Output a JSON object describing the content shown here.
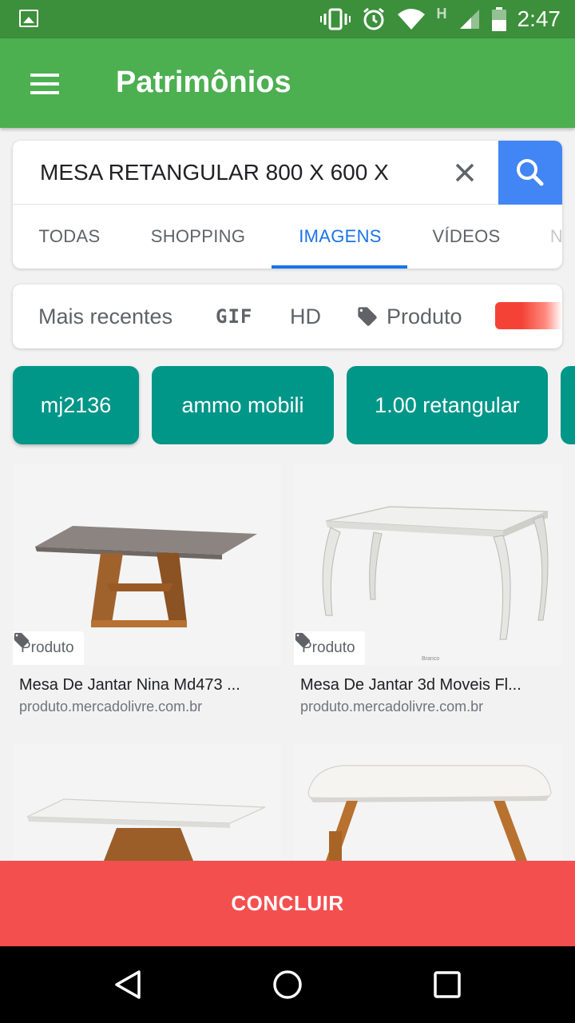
{
  "status_bar": {
    "time": "2:47",
    "network_label": "H",
    "icons": [
      "gallery-icon",
      "vibrate-icon",
      "alarm-icon",
      "wifi-icon",
      "signal-icon",
      "battery-icon"
    ]
  },
  "app_bar": {
    "title": "Patrimônios",
    "menu_icon": "menu-icon"
  },
  "search": {
    "query": "MESA RETANGULAR 800 X 600 X",
    "clear_icon": "close-icon",
    "search_icon": "search-icon",
    "accent_color": "#4285f4"
  },
  "tabs": [
    {
      "label": "TODAS",
      "active": false
    },
    {
      "label": "SHOPPING",
      "active": false
    },
    {
      "label": "IMAGENS",
      "active": true
    },
    {
      "label": "VÍDEOS",
      "active": false
    },
    {
      "label": "N",
      "active": false
    }
  ],
  "filters": {
    "recent": "Mais recentes",
    "gif": "GIF",
    "hd": "HD",
    "product": "Produto",
    "product_icon": "tag-icon",
    "color_swatch": "#f44336"
  },
  "chips": [
    {
      "label": "mj2136"
    },
    {
      "label": "ammo mobili"
    },
    {
      "label": "1.00 retangular"
    }
  ],
  "chip_color": "#009688",
  "results": [
    {
      "badge": "Produto",
      "title": "Mesa De Jantar Nina Md473 ...",
      "source": "produto.mercadolivre.com.br"
    },
    {
      "badge": "Produto",
      "title": "Mesa De Jantar 3d Moveis Fl...",
      "source": "produto.mercadolivre.com.br"
    },
    {},
    {}
  ],
  "concluir": {
    "label": "CONCLUIR",
    "color": "#f44f4f"
  },
  "nav_bar": [
    "back-icon",
    "home-icon",
    "recents-icon"
  ]
}
